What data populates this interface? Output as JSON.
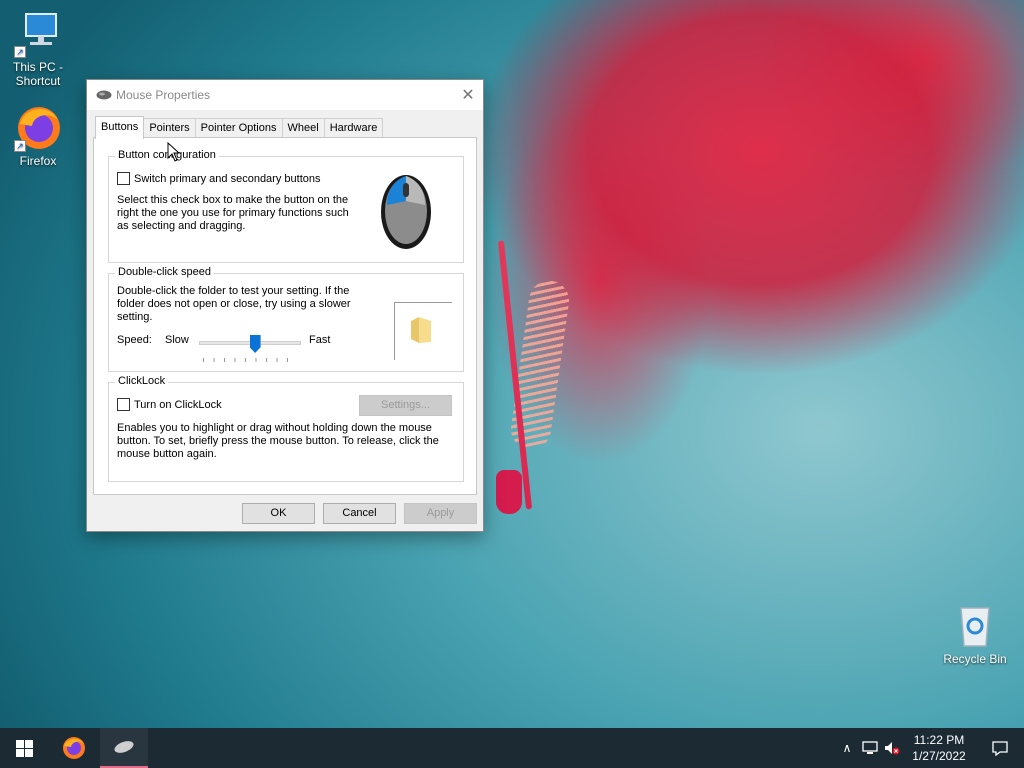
{
  "desktop": {
    "icons": [
      {
        "label": "This PC - Shortcut",
        "icon": "monitor-icon"
      },
      {
        "label": "Firefox",
        "icon": "firefox-icon"
      },
      {
        "label": "Recycle Bin",
        "icon": "recycle-bin-icon"
      }
    ]
  },
  "dialog": {
    "title": "Mouse Properties",
    "title_icon": "mouse-icon",
    "tabs": [
      {
        "label": "Buttons",
        "active": true
      },
      {
        "label": "Pointers",
        "active": false
      },
      {
        "label": "Pointer Options",
        "active": false
      },
      {
        "label": "Wheel",
        "active": false
      },
      {
        "label": "Hardware",
        "active": false
      }
    ],
    "button_config": {
      "legend": "Button configuration",
      "checkbox_label": "Switch primary and secondary buttons",
      "checked": false,
      "description": "Select this check box to make the button on the right the one you use for primary functions such as selecting and dragging."
    },
    "double_click": {
      "legend": "Double-click speed",
      "description": "Double-click the folder to test your setting. If the folder does not open or close, try using a slower setting.",
      "speed_label": "Speed:",
      "slow_label": "Slow",
      "fast_label": "Fast",
      "speed_fraction": 0.55
    },
    "clicklock": {
      "legend": "ClickLock",
      "checkbox_label": "Turn on ClickLock",
      "checked": false,
      "settings_label": "Settings...",
      "description": "Enables you to highlight or drag without holding down the mouse button. To set, briefly press the mouse button. To release, click the mouse button again."
    },
    "buttons": {
      "ok": "OK",
      "cancel": "Cancel",
      "apply": "Apply"
    }
  },
  "taskbar": {
    "items": [
      "windows-start-icon",
      "firefox-icon",
      "mouse-icon"
    ],
    "time": "11:22 PM",
    "date": "1/27/2022"
  },
  "colors": {
    "accent": "#0a74d6",
    "taskbar": "#1c2a33"
  }
}
